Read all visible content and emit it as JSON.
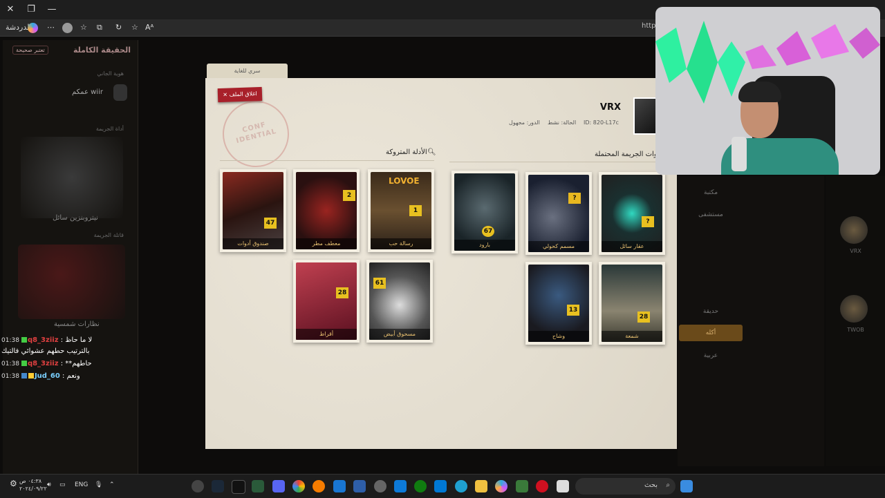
{
  "browser": {
    "profile_name": "الدردشة",
    "address_partial": "https:/"
  },
  "left_panel": {
    "title": "الحقيقة الكاملة",
    "badge": "تعتبر صحيحة",
    "sub1": "هوية الجاني",
    "user": "عمكم wiir",
    "sub2": "أداة الجريمة",
    "tool_name": "نيتروبنزين سائل",
    "sub3": "قاتلة الجريمة",
    "motive": "نظارات شمسية"
  },
  "chat": [
    {
      "time": "01:38",
      "user": "q8_3ziiz",
      "msg": "لا ما حاظ"
    },
    {
      "time": "",
      "user": "",
      "msg": "بالترتيب حطهم عشوائي فالتيك"
    },
    {
      "time": "01:38",
      "user": "q8_3ziiz",
      "msg": "**حاطهم"
    },
    {
      "time": "01:38",
      "user": "Jud_60",
      "msg": "ونعم"
    }
  ],
  "modal": {
    "tab_label": "سري للغاية",
    "close_label": "✕ اغلاق الملف",
    "stamp_text": "CONF IDENTIAL",
    "suspect": {
      "name": "VRX",
      "id": "ID: 820-L17c",
      "status": "الحالة: نشط",
      "role": "الدور: مجهول"
    },
    "weapons_title": "أدوات الجريمة المحتملة",
    "evidence_title": "الأدلة المتروكة",
    "evidence": [
      {
        "label": "صندوق أدوات",
        "num": "47"
      },
      {
        "label": "معطف مطر",
        "num": "2"
      },
      {
        "label": "رسالة حب",
        "num": "1",
        "banner": "LOVOE"
      },
      {
        "label": "أقراط",
        "num": "28"
      },
      {
        "label": "مسحوق أبيض",
        "num": "61"
      }
    ],
    "weapons": [
      {
        "label": "بارود",
        "num": "67"
      },
      {
        "label": "مسمم كحولي",
        "num": "?"
      },
      {
        "label": "عقار سائل",
        "num": "?"
      },
      {
        "label": "وشاح",
        "num": "13"
      },
      {
        "label": "شمعة",
        "num": "28"
      }
    ]
  },
  "right_panel": {
    "items": [
      "مكتبة",
      "مستشفى",
      "حديقة",
      "أكله",
      "عربية"
    ],
    "active_index": 3,
    "avatar_label": "VRX",
    "avatar_label2": "TWOB"
  },
  "taskbar": {
    "search_placeholder": "بحث",
    "lang": "ENG",
    "time": "٠٤:٣٨ ص",
    "date": "٢٠٢٤/٠٩/٢٢"
  },
  "colors": {
    "accent_red": "#a8202a",
    "label_gold": "#e8c070",
    "paper": "#e8e2d4"
  }
}
